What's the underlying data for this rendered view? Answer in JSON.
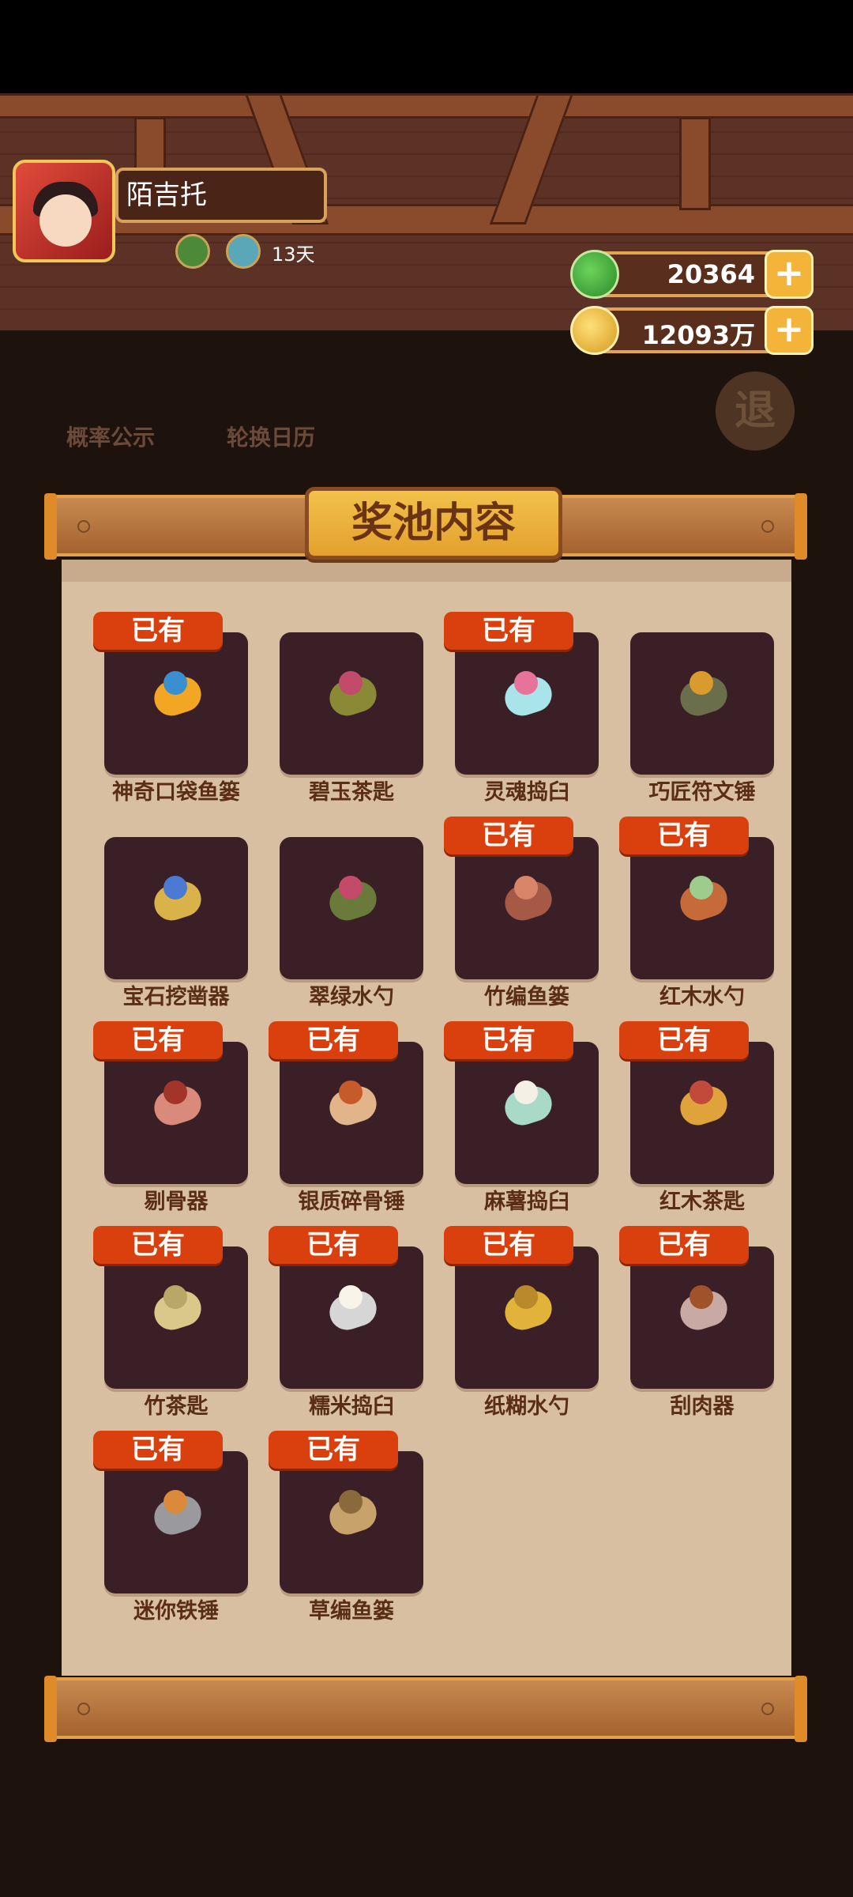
{
  "player": {
    "name": "陌吉托",
    "days": "13天"
  },
  "resources": {
    "jade": "20364",
    "coins": "12093万"
  },
  "background_buttons": {
    "probability": "概率公示",
    "calendar": "轮换日历",
    "retreat": "退"
  },
  "panel": {
    "title": "奖池内容",
    "items": [
      {
        "name": "神奇口袋鱼篓",
        "owned": true,
        "badge": "已有",
        "icon": "magic-pouch-icon"
      },
      {
        "name": "碧玉茶匙",
        "owned": false,
        "badge": "",
        "icon": "jade-scoop-icon"
      },
      {
        "name": "灵魂捣臼",
        "owned": true,
        "badge": "已有",
        "icon": "soul-mortar-icon"
      },
      {
        "name": "巧匠符文锤",
        "owned": false,
        "badge": "",
        "icon": "rune-hammer-icon"
      },
      {
        "name": "宝石挖凿器",
        "owned": false,
        "badge": "",
        "icon": "gem-chisel-icon"
      },
      {
        "name": "翠绿水勺",
        "owned": false,
        "badge": "",
        "icon": "green-ladle-icon"
      },
      {
        "name": "竹编鱼篓",
        "owned": true,
        "badge": "已有",
        "icon": "bamboo-basket-icon"
      },
      {
        "name": "红木水勺",
        "owned": true,
        "badge": "已有",
        "icon": "mahogany-ladle-icon"
      },
      {
        "name": "剔骨器",
        "owned": true,
        "badge": "已有",
        "icon": "deboner-icon"
      },
      {
        "name": "银质碎骨锤",
        "owned": true,
        "badge": "已有",
        "icon": "silver-mallet-icon"
      },
      {
        "name": "麻薯捣臼",
        "owned": true,
        "badge": "已有",
        "icon": "mochi-mortar-icon"
      },
      {
        "name": "红木茶匙",
        "owned": true,
        "badge": "已有",
        "icon": "mahogany-scoop-icon"
      },
      {
        "name": "竹茶匙",
        "owned": true,
        "badge": "已有",
        "icon": "bamboo-scoop-icon"
      },
      {
        "name": "糯米捣臼",
        "owned": true,
        "badge": "已有",
        "icon": "rice-mortar-icon"
      },
      {
        "name": "纸糊水勺",
        "owned": true,
        "badge": "已有",
        "icon": "paper-ladle-icon"
      },
      {
        "name": "刮肉器",
        "owned": true,
        "badge": "已有",
        "icon": "meat-scraper-icon"
      },
      {
        "name": "迷你铁锤",
        "owned": true,
        "badge": "已有",
        "icon": "mini-hammer-icon"
      },
      {
        "name": "草编鱼篓",
        "owned": true,
        "badge": "已有",
        "icon": "straw-basket-icon"
      }
    ]
  },
  "colors": {
    "badge": "#d9400e",
    "tile": "#3a1f26",
    "paper": "#d8bfa2",
    "title": "#f2c24a"
  }
}
